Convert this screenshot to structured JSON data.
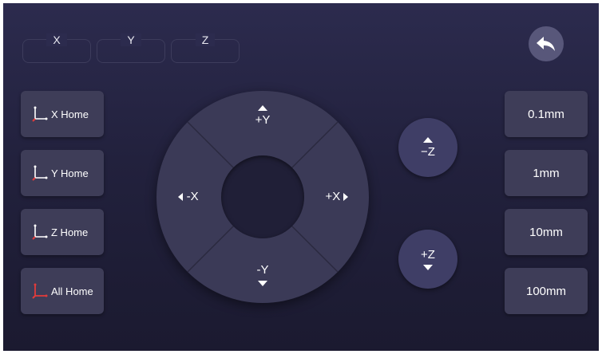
{
  "coordinates": [
    {
      "label": "X",
      "value": ""
    },
    {
      "label": "Y",
      "value": ""
    },
    {
      "label": "Z",
      "value": ""
    }
  ],
  "back_button": {
    "icon": "undo-arrow-icon"
  },
  "home_buttons": [
    {
      "label": "X Home",
      "icon": "axis-icon"
    },
    {
      "label": "Y Home",
      "icon": "axis-icon"
    },
    {
      "label": "Z Home",
      "icon": "axis-icon"
    },
    {
      "label": "All Home",
      "icon": "axis-icon"
    }
  ],
  "jog": {
    "plus_y": "+Y",
    "minus_y": "-Y",
    "minus_x": "-X",
    "plus_x": "+X"
  },
  "z_buttons": {
    "minus_z": "−Z",
    "plus_z": "+Z"
  },
  "step_sizes": [
    "0.1mm",
    "1mm",
    "10mm",
    "100mm"
  ],
  "colors": {
    "background": "#22213d",
    "button": "#3e3d58",
    "wheel": "#3b3a57",
    "z_button": "#3f3e66",
    "axis_icon": "#e23b3b"
  }
}
